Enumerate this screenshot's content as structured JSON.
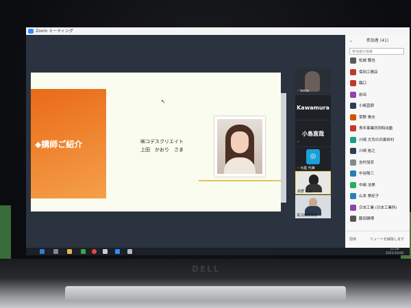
{
  "window": {
    "title": "Zoom ミーティング"
  },
  "slide": {
    "section_title": "◆講師ご紹介",
    "company": "㈱コデスクリエイト",
    "speaker": "上田　かおり　さま"
  },
  "gallery": [
    {
      "name": "keizo",
      "type": "video"
    },
    {
      "name": "Kawamura",
      "type": "name"
    },
    {
      "name": "小島直哉",
      "type": "name"
    },
    {
      "name": "大庭 代美",
      "type": "logo"
    },
    {
      "name": "高野 代美",
      "type": "video"
    },
    {
      "name": "青江田商事会",
      "type": "video"
    }
  ],
  "participants_panel": {
    "title": "参加者 (41)",
    "search_placeholder": "参加者の検索",
    "items": [
      {
        "name": "松城 蘭也",
        "color": "#5a5a5a"
      },
      {
        "name": "保田工務店",
        "color": "#c0392b"
      },
      {
        "name": "臨口",
        "color": "#c0392b"
      },
      {
        "name": "前出",
        "color": "#8e44ad"
      },
      {
        "name": "小嶋直樹",
        "color": "#2c3e50"
      },
      {
        "name": "草野 美夫",
        "color": "#d35400"
      },
      {
        "name": "青年事業所同時出動",
        "color": "#c0392b"
      },
      {
        "name": "川崎 文司の兵庫県村",
        "color": "#16a085"
      },
      {
        "name": "川崎 裕之",
        "color": "#2c3e50"
      },
      {
        "name": "吉村加奈",
        "color": "#7f8c8d"
      },
      {
        "name": "中谷陽三",
        "color": "#2980b9"
      },
      {
        "name": "中嶋 法美",
        "color": "#27ae60"
      },
      {
        "name": "山本 美紀子",
        "color": "#2980b9"
      },
      {
        "name": "日本工業 (日本工業所)",
        "color": "#8e44ad"
      },
      {
        "name": "藤田雅博",
        "color": "#555555"
      }
    ],
    "footer_left": "招待",
    "footer_right": "ミュートを解除します"
  },
  "taskbar": {
    "time": "11:56",
    "date": "2021/10/28"
  },
  "brand": "DELL"
}
